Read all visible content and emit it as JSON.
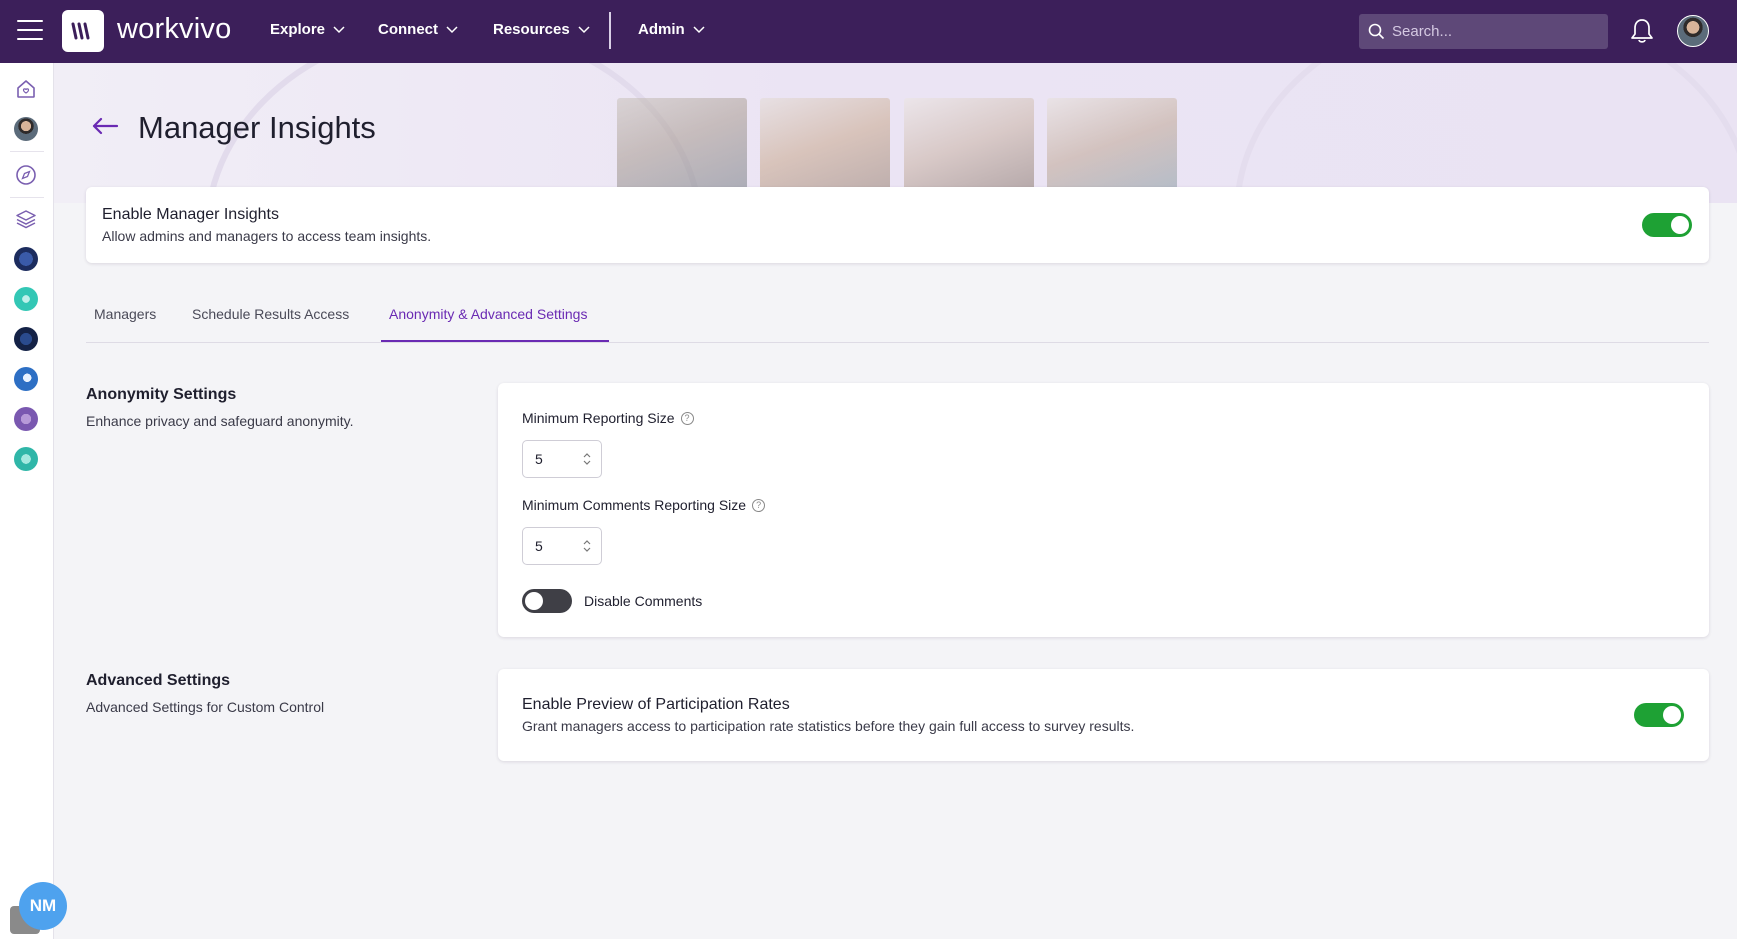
{
  "app": {
    "brand": "workvivo"
  },
  "nav": {
    "items": [
      {
        "label": "Explore"
      },
      {
        "label": "Connect"
      },
      {
        "label": "Resources"
      },
      {
        "label": "Admin"
      }
    ],
    "search_placeholder": "Search..."
  },
  "rail": {
    "user_initials": "NM"
  },
  "page": {
    "title": "Manager Insights"
  },
  "enable_card": {
    "title": "Enable Manager Insights",
    "subtitle": "Allow admins and managers to access team insights.",
    "enabled": true
  },
  "tabs": [
    {
      "label": "Managers",
      "active": false
    },
    {
      "label": "Schedule Results Access",
      "active": false
    },
    {
      "label": "Anonymity & Advanced Settings",
      "active": true
    }
  ],
  "anonymity": {
    "title": "Anonymity Settings",
    "subtitle": "Enhance privacy and safeguard anonymity.",
    "min_reporting_label": "Minimum Reporting Size",
    "min_reporting_value": "5",
    "min_comments_label": "Minimum Comments Reporting Size",
    "min_comments_value": "5",
    "disable_comments_label": "Disable Comments",
    "disable_comments_enabled": false
  },
  "advanced": {
    "title": "Advanced Settings",
    "subtitle": "Advanced Settings for Custom Control",
    "preview_title": "Enable Preview of Participation Rates",
    "preview_subtitle": "Grant managers access to participation rate statistics before they gain full access to survey results.",
    "preview_enabled": true
  },
  "colors": {
    "topbar": "#3c1f5a",
    "accent": "#6a2ab3",
    "toggle_on": "#1ea134",
    "toggle_off": "#3f3f46",
    "badge": "#4ea2ee"
  }
}
